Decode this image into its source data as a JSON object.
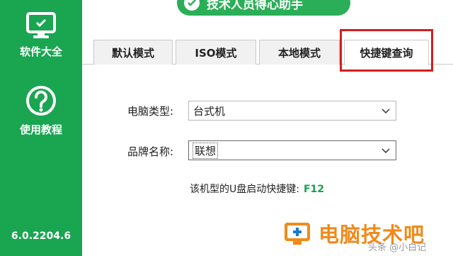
{
  "banner": {
    "text": "技术人员得心助手"
  },
  "sidebar": {
    "items": [
      {
        "label": "软件大全",
        "icon": "monitor-icon"
      },
      {
        "label": "使用教程",
        "icon": "question-icon"
      }
    ],
    "version": "6.0.2204.6"
  },
  "tabs": [
    {
      "label": "默认模式",
      "active": false
    },
    {
      "label": "ISO模式",
      "active": false
    },
    {
      "label": "本地模式",
      "active": false
    },
    {
      "label": "快捷键查询",
      "active": true
    }
  ],
  "form": {
    "computer_type_label": "电脑类型:",
    "computer_type_value": "台式机",
    "brand_label": "品牌名称:",
    "brand_value": "联想"
  },
  "hint": {
    "text": "该机型的U盘启动快捷键:",
    "key": "F12"
  },
  "watermark": {
    "text": "电脑技术吧",
    "small": "头条 @小白记"
  },
  "colors": {
    "sidebar": "#1aa551",
    "accent_key": "#16a34a",
    "highlight": "#d41d1d",
    "watermark": "#f08a1a"
  }
}
